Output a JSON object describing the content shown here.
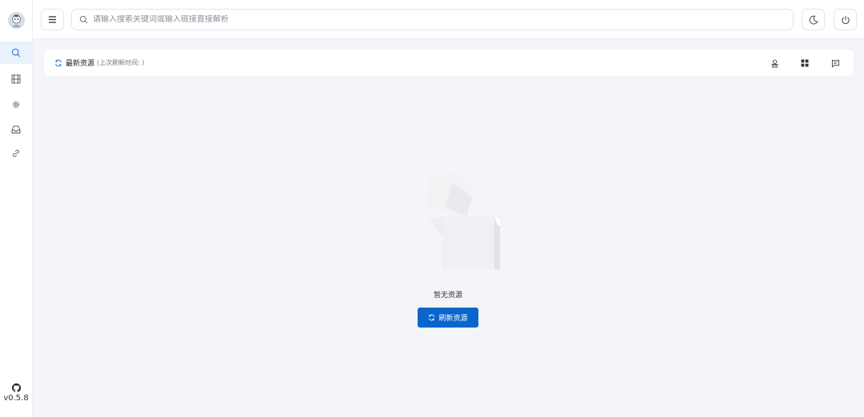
{
  "sidebar": {
    "logo": "mascot-avatar",
    "items": [
      {
        "name": "search",
        "icon": "search-icon",
        "active": true
      },
      {
        "name": "film",
        "icon": "film-icon",
        "active": false
      },
      {
        "name": "settings",
        "icon": "gear-icon",
        "active": false
      },
      {
        "name": "downloads",
        "icon": "inbox-icon",
        "active": false
      },
      {
        "name": "links",
        "icon": "link-icon",
        "active": false
      }
    ],
    "github_icon": "github-icon",
    "version": "v0.5.8"
  },
  "header": {
    "menu_icon": "menu-icon",
    "search_placeholder": "请输入搜索关键词或输入链接直接解析",
    "search_value": "",
    "theme_icon": "moon-icon",
    "power_icon": "power-icon"
  },
  "toolbar": {
    "title": "最新资源",
    "subtitle": "(上次刷新时间: )",
    "icons": [
      "filter-icon",
      "grid-icon",
      "message-icon"
    ]
  },
  "empty_state": {
    "text": "暂无资源",
    "button_label": "刷新资源"
  },
  "colors": {
    "accent": "#0a66cc",
    "active_nav_bg": "#e8f1fc",
    "background": "#f4f5f8"
  }
}
